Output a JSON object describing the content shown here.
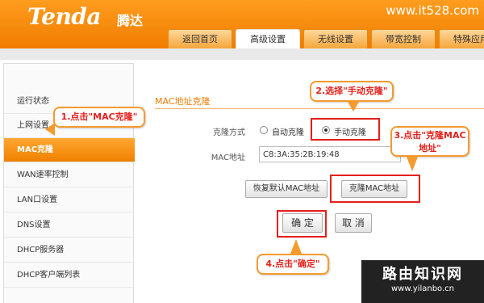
{
  "header": {
    "logo_text": "Tenda",
    "logo_cn": "腾达",
    "watermark_top": "www.it528.com",
    "tabs": [
      {
        "label": "返回首页"
      },
      {
        "label": "高级设置"
      },
      {
        "label": "无线设置"
      },
      {
        "label": "带宽控制"
      },
      {
        "label": "特殊应用"
      }
    ]
  },
  "sidebar": {
    "items": [
      {
        "label": "运行状态"
      },
      {
        "label": "上网设置"
      },
      {
        "label": "MAC克隆"
      },
      {
        "label": "WAN速率控制"
      },
      {
        "label": "LAN口设置"
      },
      {
        "label": "DNS设置"
      },
      {
        "label": "DHCP服务器"
      },
      {
        "label": "DHCP客户端列表"
      }
    ],
    "active_index": 2
  },
  "main": {
    "section_title": "MAC地址克隆",
    "clone_mode_label": "克隆方式",
    "option_auto": "自动克隆",
    "option_manual": "手动克隆",
    "selected_option": "手动克隆",
    "mac_label": "MAC地址",
    "mac_value": "C8:3A:35:2B:19:48",
    "restore_button": "恢复默认MAC地址",
    "clone_button": "克隆MAC地址",
    "confirm_button": "确 定",
    "cancel_button": "取 消"
  },
  "callouts": {
    "step1": "1.点击\"MAC克隆\"",
    "step2": "2.选择\"手动克隆\"",
    "step3_line1": "3.点击\"克隆MAC",
    "step3_line2": "地址\"",
    "step4": "4.点击\"确定\""
  },
  "watermark": {
    "title": "路由知识网",
    "url": "www.yilanbo.cn"
  },
  "colors": {
    "brand_orange": "#f07c00",
    "highlight_red": "#e4201a",
    "callout_border": "#f59a2e"
  }
}
